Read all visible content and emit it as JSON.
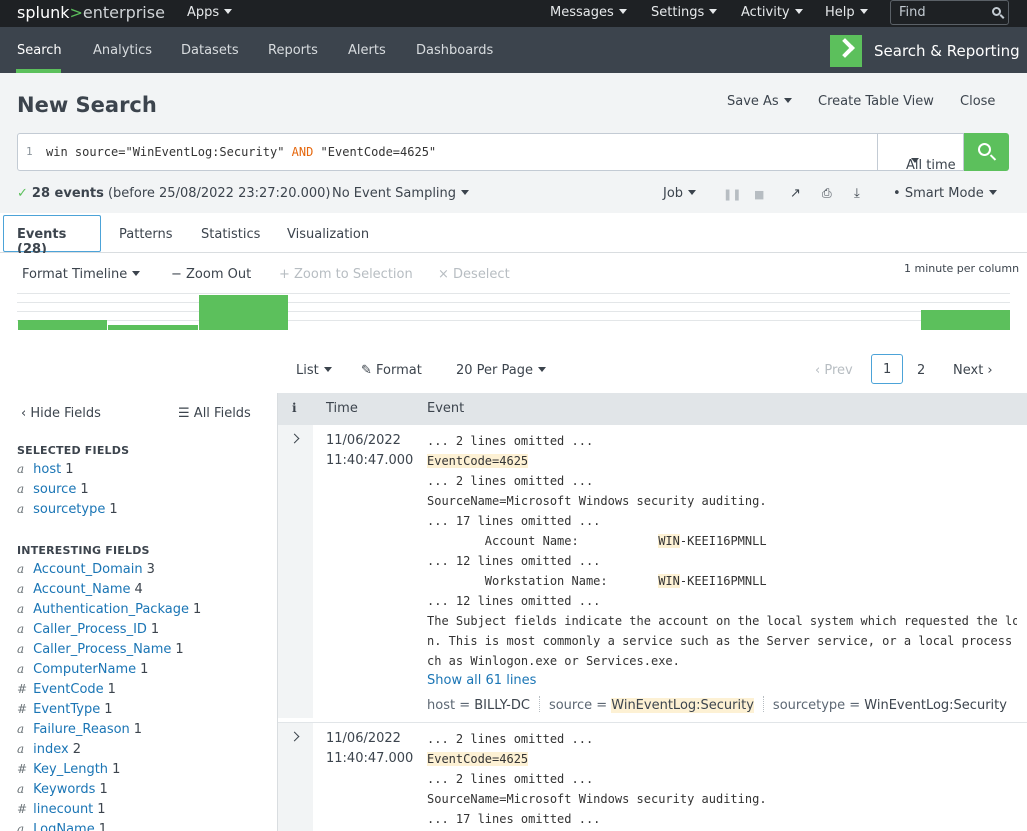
{
  "topbar": {
    "logo_splunk": "splunk",
    "logo_gt": ">",
    "logo_enterprise": "enterprise",
    "apps": "Apps",
    "messages": "Messages",
    "settings": "Settings",
    "activity": "Activity",
    "help": "Help",
    "find_placeholder": "Find"
  },
  "appbar": {
    "nav": [
      "Search",
      "Analytics",
      "Datasets",
      "Reports",
      "Alerts",
      "Dashboards"
    ],
    "app_title": "Search & Reporting"
  },
  "header": {
    "title": "New Search",
    "save_as": "Save As",
    "create_table_view": "Create Table View",
    "close": "Close"
  },
  "search": {
    "line_number": "1",
    "query_part1": "win source=\"WinEventLog:Security\" ",
    "query_keyword": "AND",
    "query_part2": " \"EventCode=4625\"",
    "time_range": "All time"
  },
  "status": {
    "events_count": "28 events",
    "before": "(before 25/08/2022 23:27:20.000)",
    "sampling": "No Event Sampling",
    "job": "Job",
    "mode": "Smart Mode"
  },
  "tabs": {
    "events": "Events (28)",
    "patterns": "Patterns",
    "statistics": "Statistics",
    "visualization": "Visualization"
  },
  "timeline": {
    "format_timeline": "Format Timeline",
    "zoom_out": "Zoom Out",
    "zoom_to_selection": "Zoom to Selection",
    "deselect": "Deselect",
    "per_column": "1 minute per column",
    "bars": [
      {
        "value": 0.28
      },
      {
        "value": 0.14
      },
      {
        "value": 1.0
      },
      {
        "value": 0.56
      }
    ]
  },
  "results": {
    "list": "List",
    "format": "Format",
    "per_page": "20 Per Page",
    "prev": "Prev",
    "page1": "1",
    "page2": "2",
    "next": "Next"
  },
  "sidebar": {
    "hide_fields": "Hide Fields",
    "all_fields": "All Fields",
    "selected_header": "SELECTED FIELDS",
    "interesting_header": "INTERESTING FIELDS",
    "selected": [
      {
        "type": "a",
        "name": "host",
        "count": "1"
      },
      {
        "type": "a",
        "name": "source",
        "count": "1"
      },
      {
        "type": "a",
        "name": "sourcetype",
        "count": "1"
      }
    ],
    "interesting": [
      {
        "type": "a",
        "name": "Account_Domain",
        "count": "3"
      },
      {
        "type": "a",
        "name": "Account_Name",
        "count": "4"
      },
      {
        "type": "a",
        "name": "Authentication_Package",
        "count": "1"
      },
      {
        "type": "a",
        "name": "Caller_Process_ID",
        "count": "1"
      },
      {
        "type": "a",
        "name": "Caller_Process_Name",
        "count": "1"
      },
      {
        "type": "a",
        "name": "ComputerName",
        "count": "1"
      },
      {
        "type": "#",
        "name": "EventCode",
        "count": "1"
      },
      {
        "type": "#",
        "name": "EventType",
        "count": "1"
      },
      {
        "type": "a",
        "name": "Failure_Reason",
        "count": "1"
      },
      {
        "type": "a",
        "name": "index",
        "count": "2"
      },
      {
        "type": "#",
        "name": "Key_Length",
        "count": "1"
      },
      {
        "type": "a",
        "name": "Keywords",
        "count": "1"
      },
      {
        "type": "#",
        "name": "linecount",
        "count": "1"
      },
      {
        "type": "a",
        "name": "LogName",
        "count": "1"
      }
    ]
  },
  "events": {
    "col_i": "i",
    "col_time": "Time",
    "col_event": "Event",
    "rows": [
      {
        "date": "11/06/2022",
        "time": "11:40:47.000",
        "lines": [
          {
            "text": "... 2 lines omitted ..."
          },
          {
            "hl": "EventCode=4625"
          },
          {
            "text": "... 2 lines omitted ..."
          },
          {
            "text": "SourceName=Microsoft Windows security auditing."
          },
          {
            "text": "... 17 lines omitted ..."
          },
          {
            "text": "        Account Name:           ",
            "hl": "WIN",
            "rest": "-KEEI16PMNLL"
          },
          {
            "text": "... 12 lines omitted ..."
          },
          {
            "text": "        Workstation Name:       ",
            "hl": "WIN",
            "rest": "-KEEI16PMNLL"
          },
          {
            "text": "... 12 lines omitted ..."
          },
          {
            "text": "The Subject fields indicate the account on the local system which requested the logo"
          },
          {
            "text": "n. This is most commonly a service such as the Server service, or a local process su"
          },
          {
            "text": "ch as Winlogon.exe or Services.exe."
          }
        ],
        "show_all": "Show all 61 lines",
        "meta": {
          "host_k": "host =",
          "host_v": "BILLY-DC",
          "source_k": "source =",
          "source_v": "WinEventLog:Security",
          "st_k": "sourcetype =",
          "st_v": "WinEventLog:Security"
        }
      },
      {
        "date": "11/06/2022",
        "time": "11:40:47.000",
        "lines": [
          {
            "text": "... 2 lines omitted ..."
          },
          {
            "hl": "EventCode=4625"
          },
          {
            "text": "... 2 lines omitted ..."
          },
          {
            "text": "SourceName=Microsoft Windows security auditing."
          },
          {
            "text": "... 17 lines omitted ..."
          }
        ]
      }
    ]
  }
}
